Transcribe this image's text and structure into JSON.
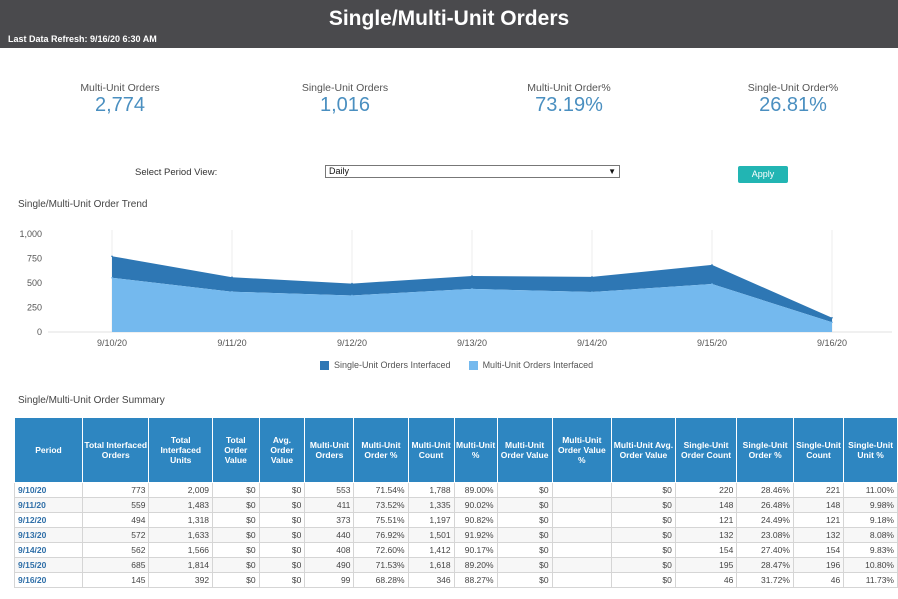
{
  "header": {
    "title": "Single/Multi-Unit Orders",
    "refresh": "Last Data Refresh: 9/16/20 6:30 AM"
  },
  "kpis": [
    {
      "label": "Multi-Unit Orders",
      "value": "2,774"
    },
    {
      "label": "Single-Unit Orders",
      "value": "1,016"
    },
    {
      "label": "Multi-Unit Order%",
      "value": "73.19%"
    },
    {
      "label": "Single-Unit Order%",
      "value": "26.81%"
    }
  ],
  "controls": {
    "period_label": "Select Period View:",
    "period_value": "Daily",
    "apply_label": "Apply"
  },
  "trend_title": "Single/Multi-Unit Order Trend",
  "summary_title": "Single/Multi-Unit Order Summary",
  "colors": {
    "single": "#2e77b4",
    "multi": "#74b9ee",
    "header_bg": "#4a4a4d",
    "table_header": "#2e86c1",
    "apply": "#22b5b3"
  },
  "chart_data": {
    "type": "area",
    "stacked": true,
    "x": [
      "9/10/20",
      "9/11/20",
      "9/12/20",
      "9/13/20",
      "9/14/20",
      "9/15/20",
      "9/16/20"
    ],
    "series": [
      {
        "name": "Single-Unit Orders Interfaced",
        "values": [
          220,
          148,
          121,
          132,
          154,
          195,
          46
        ]
      },
      {
        "name": "Multi-Unit Orders Interfaced",
        "values": [
          553,
          411,
          373,
          440,
          408,
          490,
          99
        ]
      }
    ],
    "yticks": [
      "0",
      "250",
      "500",
      "750",
      "1,000"
    ],
    "ylim": [
      0,
      1000
    ],
    "grid": "vertical",
    "legend": "bottom"
  },
  "table": {
    "headers": [
      "Period",
      "Total Interfaced Orders",
      "Total Interfaced Units",
      "Total Order Value",
      "Avg. Order Value",
      "Multi-Unit Orders",
      "Multi-Unit Order %",
      "Multi-Unit Count",
      "Multi-Unit %",
      "Multi-Unit Order Value",
      "Multi-Unit Order Value %",
      "Multi-Unit Avg. Order Value",
      "Single-Unit Order Count",
      "Single-Unit Order %",
      "Single-Unit Count",
      "Single-Unit Unit %"
    ],
    "rows": [
      [
        "9/10/20",
        "773",
        "2,009",
        "$0",
        "$0",
        "553",
        "71.54%",
        "1,788",
        "89.00%",
        "$0",
        "",
        "$0",
        "220",
        "28.46%",
        "221",
        "11.00%"
      ],
      [
        "9/11/20",
        "559",
        "1,483",
        "$0",
        "$0",
        "411",
        "73.52%",
        "1,335",
        "90.02%",
        "$0",
        "",
        "$0",
        "148",
        "26.48%",
        "148",
        "9.98%"
      ],
      [
        "9/12/20",
        "494",
        "1,318",
        "$0",
        "$0",
        "373",
        "75.51%",
        "1,197",
        "90.82%",
        "$0",
        "",
        "$0",
        "121",
        "24.49%",
        "121",
        "9.18%"
      ],
      [
        "9/13/20",
        "572",
        "1,633",
        "$0",
        "$0",
        "440",
        "76.92%",
        "1,501",
        "91.92%",
        "$0",
        "",
        "$0",
        "132",
        "23.08%",
        "132",
        "8.08%"
      ],
      [
        "9/14/20",
        "562",
        "1,566",
        "$0",
        "$0",
        "408",
        "72.60%",
        "1,412",
        "90.17%",
        "$0",
        "",
        "$0",
        "154",
        "27.40%",
        "154",
        "9.83%"
      ],
      [
        "9/15/20",
        "685",
        "1,814",
        "$0",
        "$0",
        "490",
        "71.53%",
        "1,618",
        "89.20%",
        "$0",
        "",
        "$0",
        "195",
        "28.47%",
        "196",
        "10.80%"
      ],
      [
        "9/16/20",
        "145",
        "392",
        "$0",
        "$0",
        "99",
        "68.28%",
        "346",
        "88.27%",
        "$0",
        "",
        "$0",
        "46",
        "31.72%",
        "46",
        "11.73%"
      ]
    ]
  }
}
